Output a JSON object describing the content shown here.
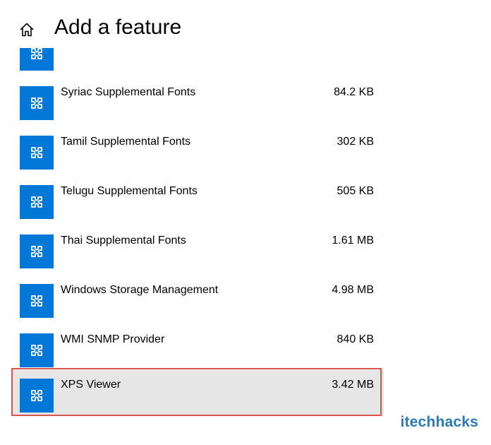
{
  "header": {
    "title": "Add a feature",
    "home_icon": "home-icon"
  },
  "features": [
    {
      "name": "",
      "size": "",
      "icon": "puzzle-icon",
      "partial": true
    },
    {
      "name": "Syriac Supplemental Fonts",
      "size": "84.2 KB",
      "icon": "puzzle-icon"
    },
    {
      "name": "Tamil Supplemental Fonts",
      "size": "302 KB",
      "icon": "puzzle-icon"
    },
    {
      "name": "Telugu Supplemental Fonts",
      "size": "505 KB",
      "icon": "puzzle-icon"
    },
    {
      "name": "Thai Supplemental Fonts",
      "size": "1.61 MB",
      "icon": "puzzle-icon"
    },
    {
      "name": "Windows Storage Management",
      "size": "4.98 MB",
      "icon": "puzzle-icon"
    },
    {
      "name": "WMI SNMP Provider",
      "size": "840 KB",
      "icon": "puzzle-icon"
    },
    {
      "name": "XPS Viewer",
      "size": "3.42 MB",
      "icon": "puzzle-icon",
      "selected": true
    }
  ],
  "colors": {
    "accent": "#0078d7",
    "selected_bg": "#e6e6e6",
    "highlight": "#d9534f",
    "watermark": "#2a7ab8"
  },
  "watermark": {
    "text": "itechhacks"
  }
}
